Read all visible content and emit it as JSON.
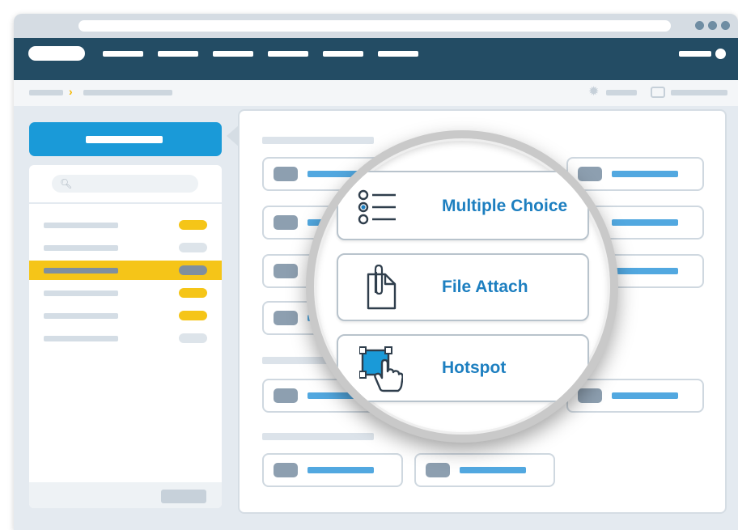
{
  "colors": {
    "accent": "#1a9ad8",
    "navbar": "#234c64",
    "highlight": "#f5c518",
    "link": "#1d7fc0"
  },
  "breadcrumb": {
    "separator": "›"
  },
  "sidebar": {
    "search_icon": "search-icon",
    "items": [
      {
        "tag_color": "#f5c518",
        "selected": false
      },
      {
        "tag_color": "#dde4ea",
        "selected": false
      },
      {
        "tag_color": "#7f8f9e",
        "selected": true
      },
      {
        "tag_color": "#f5c518",
        "selected": false
      },
      {
        "tag_color": "#f5c518",
        "selected": false
      },
      {
        "tag_color": "#dde4ea",
        "selected": false
      }
    ]
  },
  "question_types": [
    {
      "label": "Multiple Choice",
      "icon": "multiple-choice-icon"
    },
    {
      "label": "File Attach",
      "icon": "paperclip-document-icon"
    },
    {
      "label": "Hotspot",
      "icon": "hand-pointer-icon"
    }
  ]
}
